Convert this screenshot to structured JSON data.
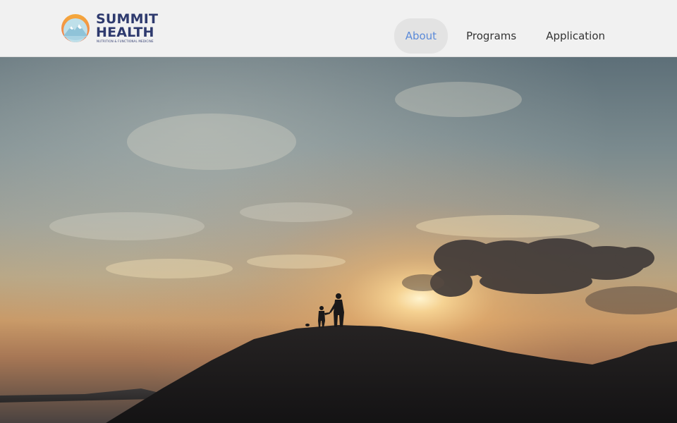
{
  "brand": {
    "line1": "SUMMIT",
    "line2": "HEALTH",
    "tagline": "NUTRITION & FUNCTIONAL MEDICINE",
    "color": "#2e3a6e"
  },
  "nav": {
    "items": [
      {
        "label": "About",
        "active": true
      },
      {
        "label": "Programs",
        "active": false
      },
      {
        "label": "Application",
        "active": false
      }
    ],
    "active_color": "#5b8ad8"
  },
  "hero": {
    "scene": "silhouette of adult and child holding hands on hilltop at sunset"
  }
}
